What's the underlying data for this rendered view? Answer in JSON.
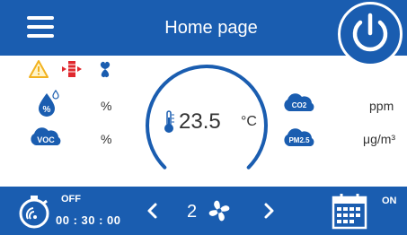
{
  "header": {
    "title": "Home page",
    "menu_icon": "menu-icon",
    "power_icon": "power-icon"
  },
  "alerts": {
    "icons": [
      "warning-icon",
      "filter-alert-icon",
      "fan-alert-icon"
    ]
  },
  "metrics": {
    "humidity": {
      "icon": "humidity-icon",
      "value": "%"
    },
    "voc": {
      "icon": "voc-icon",
      "icon_label": "VOC",
      "value": "%"
    },
    "co2": {
      "icon": "co2-icon",
      "icon_label": "CO2",
      "value": "ppm"
    },
    "pm25": {
      "icon": "pm25-icon",
      "icon_label": "PM2.5",
      "value": "μg/m³"
    }
  },
  "temperature": {
    "icon": "thermometer-icon",
    "value": "23.5",
    "unit": "°C",
    "gauge_fraction": 0.75
  },
  "footer": {
    "timer": {
      "icon": "timer-icon",
      "state": "OFF",
      "time": "00 : 30 : 00"
    },
    "speed": {
      "value": "2",
      "icon": "fan-icon",
      "prev_icon": "chevron-left-icon",
      "next_icon": "chevron-right-icon"
    },
    "schedule": {
      "icon": "schedule-icon",
      "state": "ON"
    }
  },
  "colors": {
    "primary": "#1a5db0",
    "warning": "#f2b21f",
    "alert_red": "#e0282e",
    "icon_blue": "#1a5db0"
  }
}
